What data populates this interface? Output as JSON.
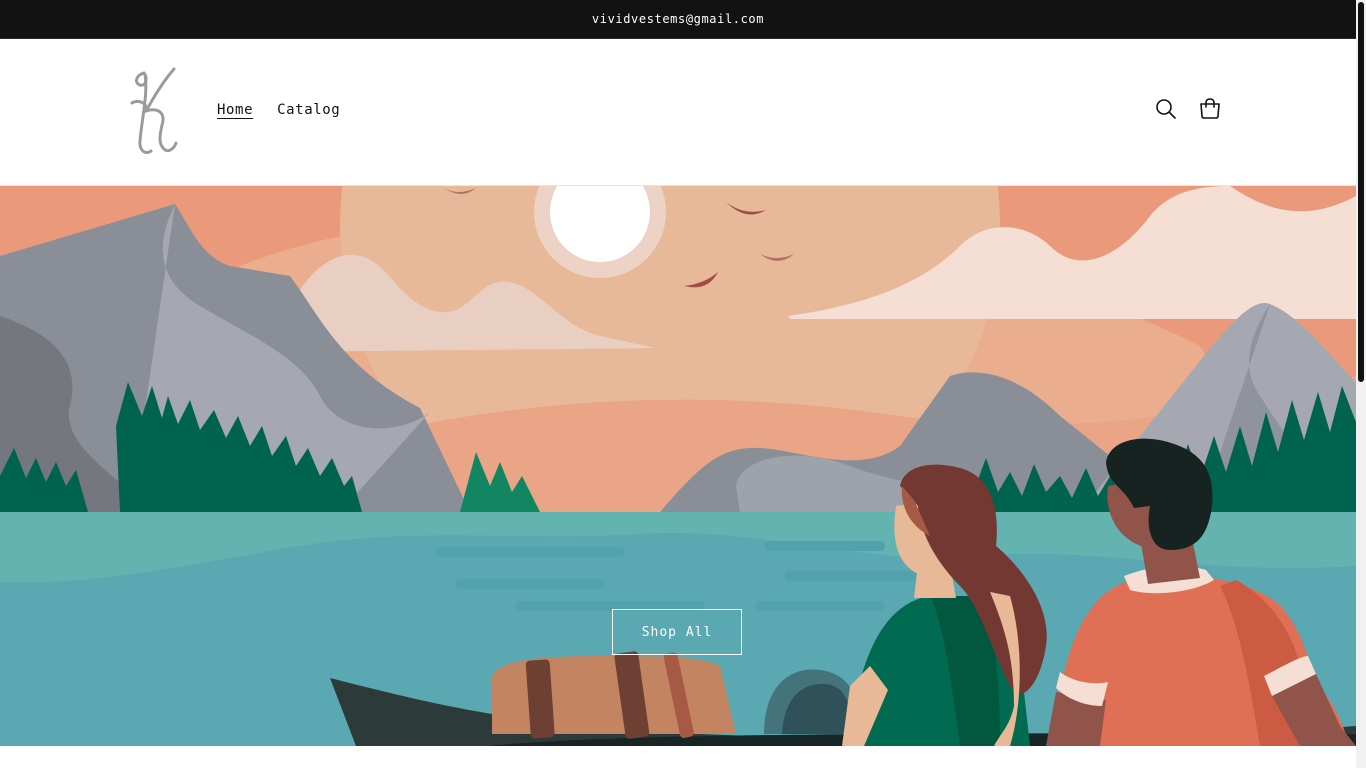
{
  "announcement": {
    "text": "vividvestems@gmail.com"
  },
  "header": {
    "logo_icon": "script-v-logo",
    "nav": [
      {
        "label": "Home",
        "active": true
      },
      {
        "label": "Catalog",
        "active": false
      }
    ],
    "search_icon": "search-icon",
    "cart_icon": "cart-icon"
  },
  "hero": {
    "illustration": "lake-mountain-sunset-with-two-people-in-canoe",
    "button_label": "Shop All"
  },
  "colors": {
    "announcement_bg": "#121212",
    "sky_top": "#ea9a7a",
    "sky_glow": "#e8b999",
    "water": "#5aa8b1",
    "forest": "#00634d",
    "mountain": "#8a8f97"
  }
}
